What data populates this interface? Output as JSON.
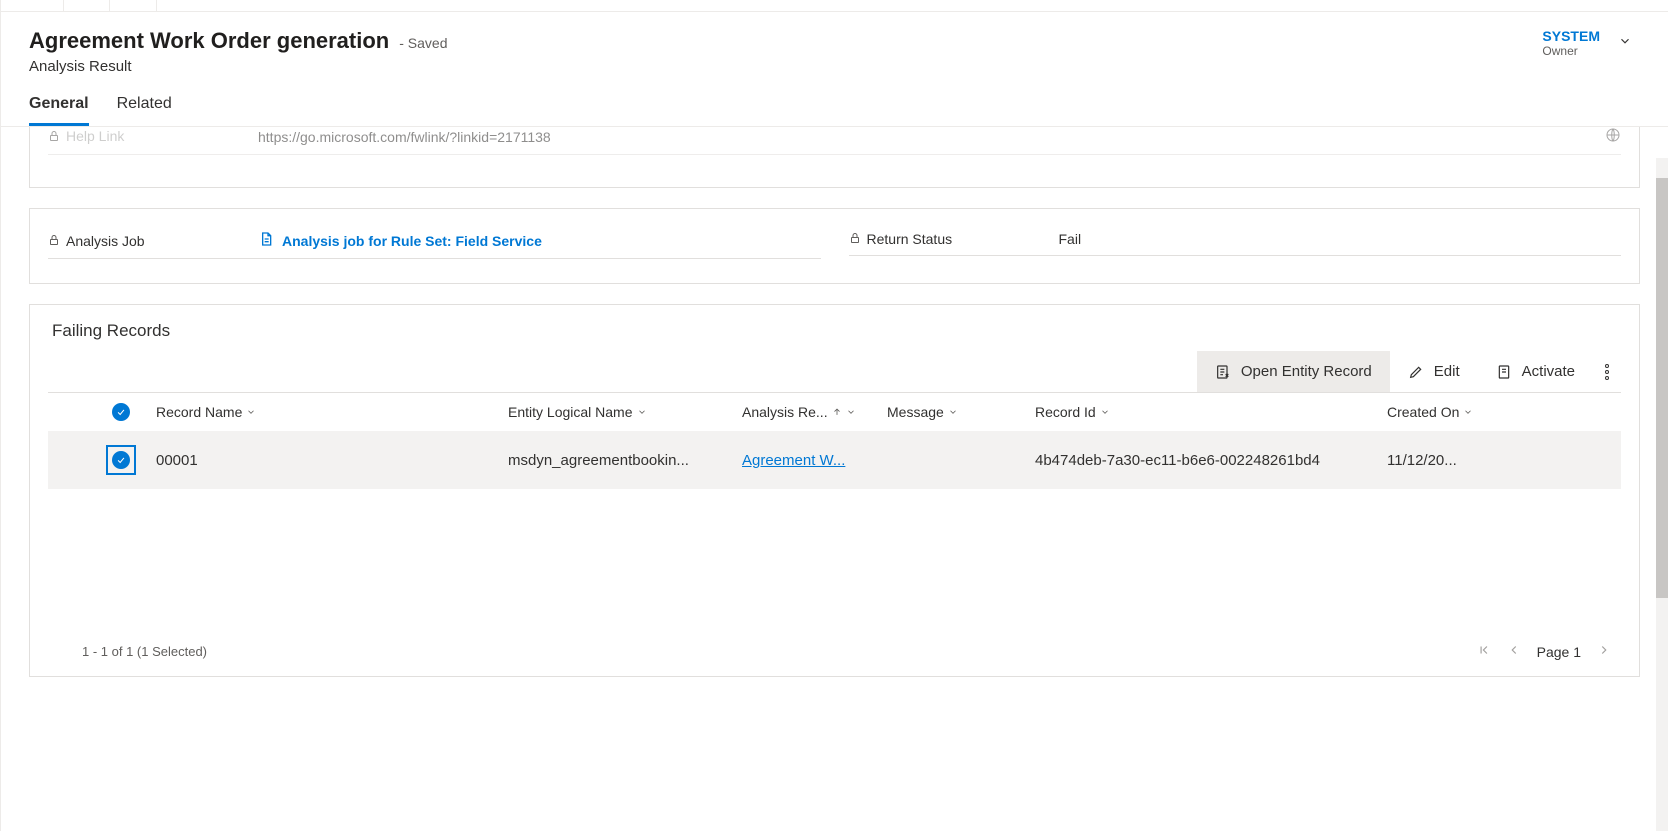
{
  "header": {
    "title": "Agreement Work Order generation",
    "saved_state": "- Saved",
    "subtitle": "Analysis Result",
    "owner_value": "SYSTEM",
    "owner_label": "Owner"
  },
  "tabs": {
    "general": "General",
    "related": "Related"
  },
  "fields": {
    "help_link_label": "Help Link",
    "help_link_value": "https://go.microsoft.com/fwlink/?linkid=2171138",
    "analysis_job_label": "Analysis Job",
    "analysis_job_value": "Analysis job for Rule Set: Field Service",
    "return_status_label": "Return Status",
    "return_status_value": "Fail"
  },
  "grid": {
    "section_title": "Failing Records",
    "commands": {
      "open_entity": "Open Entity Record",
      "edit": "Edit",
      "activate": "Activate"
    },
    "columns": {
      "record_name": "Record Name",
      "entity_logical_name": "Entity Logical Name",
      "analysis_re": "Analysis Re...",
      "message": "Message",
      "record_id": "Record Id",
      "created_on": "Created On"
    },
    "rows": [
      {
        "record_name": "00001",
        "entity_logical_name": "msdyn_agreementbookin...",
        "analysis_result": "Agreement W...",
        "message": "",
        "record_id": "4b474deb-7a30-ec11-b6e6-002248261bd4",
        "created_on": "11/12/20..."
      }
    ],
    "footer": {
      "count_text": "1 - 1 of 1 (1 Selected)",
      "page_label": "Page 1"
    }
  }
}
